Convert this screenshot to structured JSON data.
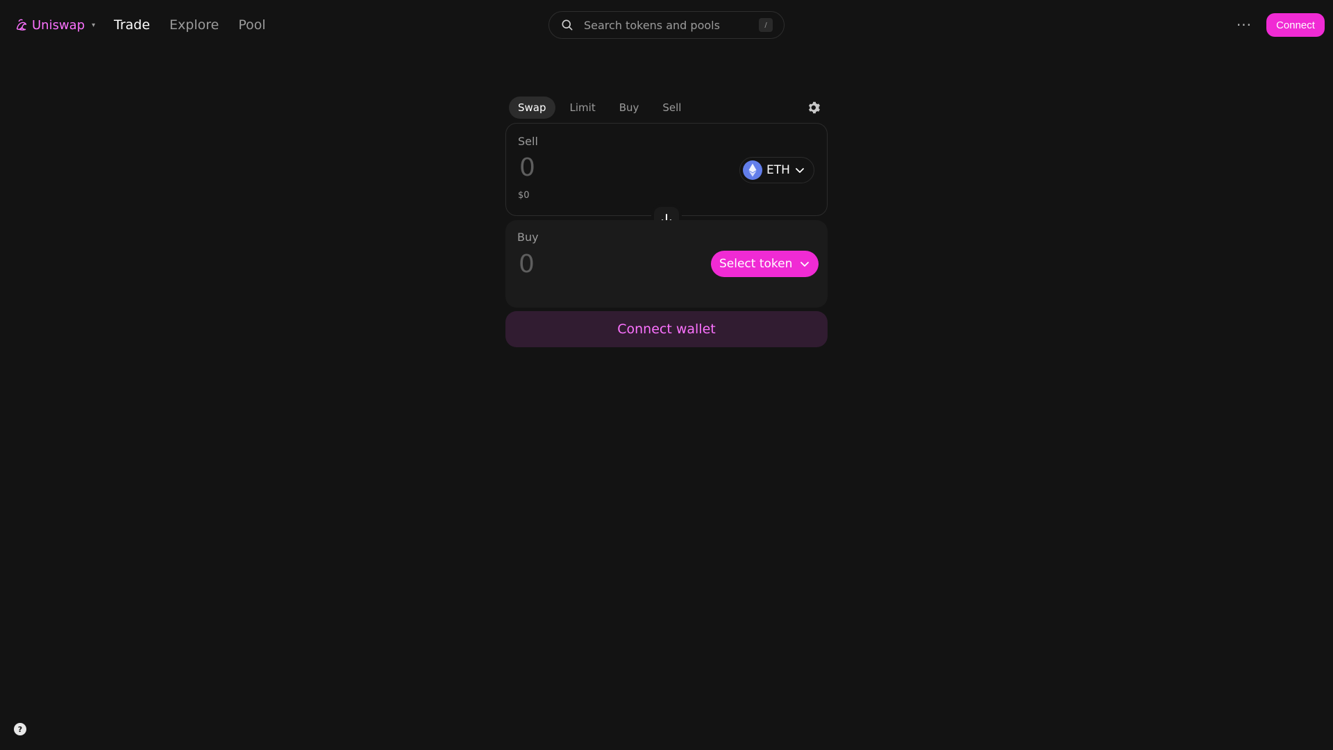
{
  "nav": {
    "brand": "Uniswap",
    "brand_caret": "▾",
    "links": [
      {
        "label": "Trade",
        "active": true
      },
      {
        "label": "Explore",
        "active": false
      },
      {
        "label": "Pool",
        "active": false
      }
    ],
    "more_label": "···",
    "connect_label": "Connect"
  },
  "search": {
    "placeholder": "Search tokens and pools",
    "shortcut": "/"
  },
  "swap": {
    "tabs": [
      {
        "label": "Swap",
        "active": true
      },
      {
        "label": "Limit",
        "active": false
      },
      {
        "label": "Buy",
        "active": false
      },
      {
        "label": "Sell",
        "active": false
      }
    ],
    "sell": {
      "label": "Sell",
      "amount_placeholder": "0",
      "usd_value": "$0",
      "token_symbol": "ETH"
    },
    "buy": {
      "label": "Buy",
      "amount_placeholder": "0",
      "select_token_label": "Select token"
    },
    "connect_wallet_label": "Connect wallet"
  },
  "help": {
    "label": "?"
  },
  "colors": {
    "background": "#131313",
    "accent": "#fc72ff",
    "accent_button": "#f02bd4",
    "muted_text": "#9b9b9b"
  }
}
